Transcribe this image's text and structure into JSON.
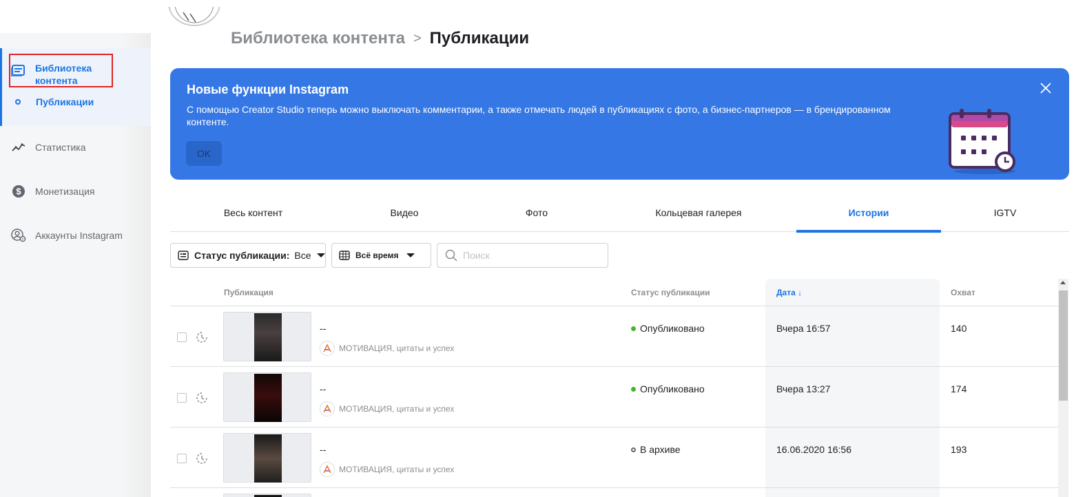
{
  "sidebar": {
    "library_label": "Библиотека контента",
    "publications_label": "Публикации",
    "items": [
      {
        "label": "Статистика",
        "icon": "stats-line-icon"
      },
      {
        "label": "Монетизация",
        "icon": "dollar-icon"
      },
      {
        "label": "Аккаунты Instagram",
        "icon": "account-settings-icon"
      }
    ]
  },
  "header": {
    "breadcrumb_parent": "Библиотека контента",
    "breadcrumb_separator": ">",
    "breadcrumb_current": "Публикации"
  },
  "banner": {
    "title": "Новые функции Instagram",
    "text": "С помощью Creator Studio теперь можно выключать комментарии, а также отмечать людей в публикациях с фото, а бизнес-партнеров — в брендированном контенте.",
    "ok_label": "OK",
    "color": "#3578e5"
  },
  "tabs": [
    {
      "label": "Весь контент"
    },
    {
      "label": "Видео"
    },
    {
      "label": "Фото"
    },
    {
      "label": "Кольцевая галерея"
    },
    {
      "label": "Истории",
      "active": true
    },
    {
      "label": "IGTV"
    }
  ],
  "filters": {
    "status_label": "Статус публикации:",
    "status_value": "Все",
    "time_label": "Всё время",
    "search_placeholder": "Поиск"
  },
  "table": {
    "headers": {
      "publication": "Публикация",
      "status": "Статус публикации",
      "date": "Дата ↓",
      "reach": "Охват"
    },
    "rows": [
      {
        "title": "--",
        "account": "МОТИВАЦИЯ, цитаты и успех",
        "status": "Опубликовано",
        "status_color": "#42b72a",
        "date": "Вчера 16:57",
        "reach": "140"
      },
      {
        "title": "--",
        "account": "МОТИВАЦИЯ, цитаты и успех",
        "status": "Опубликовано",
        "status_color": "#42b72a",
        "date": "Вчера 13:27",
        "reach": "174"
      },
      {
        "title": "--",
        "account": "МОТИВАЦИЯ, цитаты и успех",
        "status": "В архиве",
        "status_color": "#606770",
        "date": "16.06.2020 16:56",
        "reach": "193"
      }
    ]
  },
  "colors": {
    "accent": "#1b74e4",
    "highlight": "#e02020"
  }
}
